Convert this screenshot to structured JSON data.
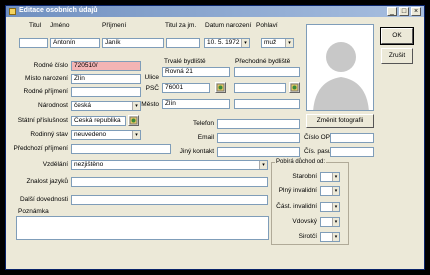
{
  "window": {
    "title": "Editace osobních údajů",
    "controls": {
      "minimize": "_",
      "maximize": "□",
      "close": "×"
    }
  },
  "header": {
    "titul_label": "Titul",
    "jmeno_label": "Jméno",
    "prijmeni_label": "Příjmení",
    "titul_za_label": "Titul za jm.",
    "datum_label": "Datum narození",
    "pohlavi_label": "Pohlaví",
    "titul_value": "",
    "jmeno_value": "Antonín",
    "prijmeni_value": "Janík",
    "titul_za_value": "",
    "datum_value": "10. 5. 1972",
    "pohlavi_value": "muž"
  },
  "personal": {
    "rodne_cislo_label": "Rodné číslo",
    "rodne_cislo_value": "720510/",
    "misto_narozeni_label": "Místo narození",
    "misto_narozeni_value": "Zlín",
    "rodne_prijmeni_label": "Rodné příjmení",
    "rodne_prijmeni_value": "",
    "narodnost_label": "Národnost",
    "narodnost_value": "česká",
    "statni_prislusnost_label": "Státní příslušnost",
    "statni_prislusnost_value": "Česká republika",
    "rodinny_stav_label": "Rodinný stav",
    "rodinny_stav_value": "neuvedeno",
    "predchozi_prijmeni_label": "Předchozí příjmení",
    "predchozi_prijmeni_value": "",
    "vzdelani_label": "Vzdělání",
    "vzdelani_value": "nezjištěno",
    "znalost_jazyku_label": "Znalost jazyků",
    "znalost_jazyku_value": "",
    "dalsi_dovednosti_label": "Další dovednosti",
    "dalsi_dovednosti_value": "",
    "poznamka_label": "Poznámka",
    "poznamka_value": ""
  },
  "address": {
    "trvale_label": "Trvalé bydliště",
    "prechodne_label": "Přechodné bydliště",
    "ulice_label": "Ulice",
    "psc_label": "PSČ",
    "mesto_label": "Město",
    "trvale_ulice": "Rovná 21",
    "trvale_psc": "76001",
    "trvale_mesto": "Zlín",
    "prechodne_ulice": "",
    "prechodne_psc": "",
    "prechodne_mesto": ""
  },
  "contact": {
    "telefon_label": "Telefon",
    "telefon_value": "",
    "email_label": "Email",
    "email_value": "",
    "jiny_kontakt_label": "Jiný kontakt",
    "jiny_kontakt_value": "",
    "cislo_op_label": "Číslo OP",
    "cislo_op_value": "",
    "cis_pasu_label": "Čís. pasu",
    "cis_pasu_value": ""
  },
  "pension": {
    "group_label": "Pobírá důchod od:",
    "items": [
      {
        "label": "Starobní",
        "value": ""
      },
      {
        "label": "Plný invalidní",
        "value": ""
      },
      {
        "label": "Část. invalidní",
        "value": ""
      },
      {
        "label": "Vdovský",
        "value": ""
      },
      {
        "label": "Sirotčí",
        "value": ""
      }
    ]
  },
  "buttons": {
    "ok": "OK",
    "cancel": "Zrušit",
    "change_photo": "Změnit fotografii"
  },
  "icons": {
    "dropdown": "▾",
    "lookup": "lookup-icon",
    "photo": "person-silhouette-icon"
  }
}
